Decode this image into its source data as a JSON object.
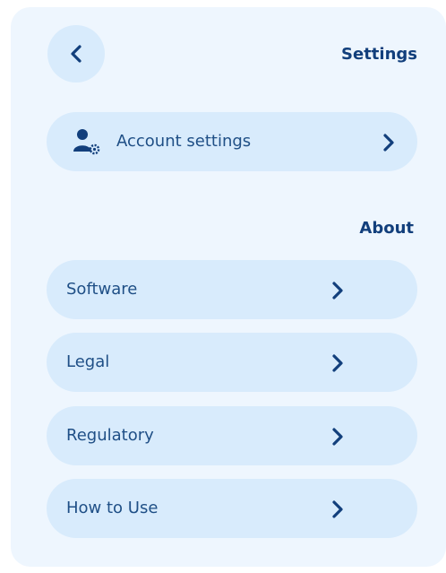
{
  "header": {
    "back_icon": "chevron-left-icon",
    "title": "Settings"
  },
  "account": {
    "icon": "user-settings-icon",
    "label": "Account settings",
    "chevron_icon": "chevron-right-icon"
  },
  "about": {
    "title": "About",
    "items": [
      {
        "label": "Software"
      },
      {
        "label": "Legal"
      },
      {
        "label": "Regulatory"
      },
      {
        "label": "How to Use"
      }
    ]
  },
  "colors": {
    "panel_bg": "#eef6fe",
    "item_bg": "#d8ebfc",
    "accent": "#123f7c",
    "label_text": "#1f4f86"
  }
}
